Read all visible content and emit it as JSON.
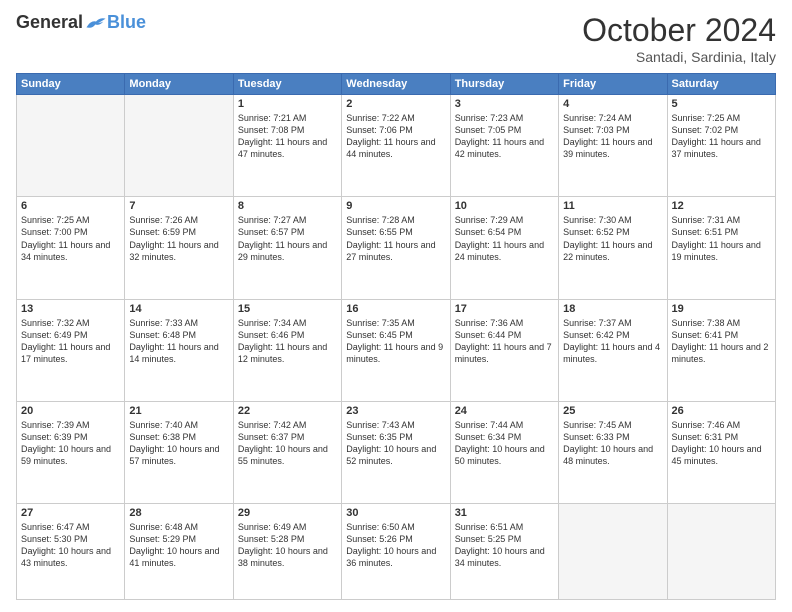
{
  "header": {
    "logo_general": "General",
    "logo_blue": "Blue",
    "month_title": "October 2024",
    "location": "Santadi, Sardinia, Italy"
  },
  "days_of_week": [
    "Sunday",
    "Monday",
    "Tuesday",
    "Wednesday",
    "Thursday",
    "Friday",
    "Saturday"
  ],
  "weeks": [
    [
      {
        "day": "",
        "empty": true
      },
      {
        "day": "",
        "empty": true
      },
      {
        "day": "1",
        "sunrise": "Sunrise: 7:21 AM",
        "sunset": "Sunset: 7:08 PM",
        "daylight": "Daylight: 11 hours and 47 minutes."
      },
      {
        "day": "2",
        "sunrise": "Sunrise: 7:22 AM",
        "sunset": "Sunset: 7:06 PM",
        "daylight": "Daylight: 11 hours and 44 minutes."
      },
      {
        "day": "3",
        "sunrise": "Sunrise: 7:23 AM",
        "sunset": "Sunset: 7:05 PM",
        "daylight": "Daylight: 11 hours and 42 minutes."
      },
      {
        "day": "4",
        "sunrise": "Sunrise: 7:24 AM",
        "sunset": "Sunset: 7:03 PM",
        "daylight": "Daylight: 11 hours and 39 minutes."
      },
      {
        "day": "5",
        "sunrise": "Sunrise: 7:25 AM",
        "sunset": "Sunset: 7:02 PM",
        "daylight": "Daylight: 11 hours and 37 minutes."
      }
    ],
    [
      {
        "day": "6",
        "sunrise": "Sunrise: 7:25 AM",
        "sunset": "Sunset: 7:00 PM",
        "daylight": "Daylight: 11 hours and 34 minutes."
      },
      {
        "day": "7",
        "sunrise": "Sunrise: 7:26 AM",
        "sunset": "Sunset: 6:59 PM",
        "daylight": "Daylight: 11 hours and 32 minutes."
      },
      {
        "day": "8",
        "sunrise": "Sunrise: 7:27 AM",
        "sunset": "Sunset: 6:57 PM",
        "daylight": "Daylight: 11 hours and 29 minutes."
      },
      {
        "day": "9",
        "sunrise": "Sunrise: 7:28 AM",
        "sunset": "Sunset: 6:55 PM",
        "daylight": "Daylight: 11 hours and 27 minutes."
      },
      {
        "day": "10",
        "sunrise": "Sunrise: 7:29 AM",
        "sunset": "Sunset: 6:54 PM",
        "daylight": "Daylight: 11 hours and 24 minutes."
      },
      {
        "day": "11",
        "sunrise": "Sunrise: 7:30 AM",
        "sunset": "Sunset: 6:52 PM",
        "daylight": "Daylight: 11 hours and 22 minutes."
      },
      {
        "day": "12",
        "sunrise": "Sunrise: 7:31 AM",
        "sunset": "Sunset: 6:51 PM",
        "daylight": "Daylight: 11 hours and 19 minutes."
      }
    ],
    [
      {
        "day": "13",
        "sunrise": "Sunrise: 7:32 AM",
        "sunset": "Sunset: 6:49 PM",
        "daylight": "Daylight: 11 hours and 17 minutes."
      },
      {
        "day": "14",
        "sunrise": "Sunrise: 7:33 AM",
        "sunset": "Sunset: 6:48 PM",
        "daylight": "Daylight: 11 hours and 14 minutes."
      },
      {
        "day": "15",
        "sunrise": "Sunrise: 7:34 AM",
        "sunset": "Sunset: 6:46 PM",
        "daylight": "Daylight: 11 hours and 12 minutes."
      },
      {
        "day": "16",
        "sunrise": "Sunrise: 7:35 AM",
        "sunset": "Sunset: 6:45 PM",
        "daylight": "Daylight: 11 hours and 9 minutes."
      },
      {
        "day": "17",
        "sunrise": "Sunrise: 7:36 AM",
        "sunset": "Sunset: 6:44 PM",
        "daylight": "Daylight: 11 hours and 7 minutes."
      },
      {
        "day": "18",
        "sunrise": "Sunrise: 7:37 AM",
        "sunset": "Sunset: 6:42 PM",
        "daylight": "Daylight: 11 hours and 4 minutes."
      },
      {
        "day": "19",
        "sunrise": "Sunrise: 7:38 AM",
        "sunset": "Sunset: 6:41 PM",
        "daylight": "Daylight: 11 hours and 2 minutes."
      }
    ],
    [
      {
        "day": "20",
        "sunrise": "Sunrise: 7:39 AM",
        "sunset": "Sunset: 6:39 PM",
        "daylight": "Daylight: 10 hours and 59 minutes."
      },
      {
        "day": "21",
        "sunrise": "Sunrise: 7:40 AM",
        "sunset": "Sunset: 6:38 PM",
        "daylight": "Daylight: 10 hours and 57 minutes."
      },
      {
        "day": "22",
        "sunrise": "Sunrise: 7:42 AM",
        "sunset": "Sunset: 6:37 PM",
        "daylight": "Daylight: 10 hours and 55 minutes."
      },
      {
        "day": "23",
        "sunrise": "Sunrise: 7:43 AM",
        "sunset": "Sunset: 6:35 PM",
        "daylight": "Daylight: 10 hours and 52 minutes."
      },
      {
        "day": "24",
        "sunrise": "Sunrise: 7:44 AM",
        "sunset": "Sunset: 6:34 PM",
        "daylight": "Daylight: 10 hours and 50 minutes."
      },
      {
        "day": "25",
        "sunrise": "Sunrise: 7:45 AM",
        "sunset": "Sunset: 6:33 PM",
        "daylight": "Daylight: 10 hours and 48 minutes."
      },
      {
        "day": "26",
        "sunrise": "Sunrise: 7:46 AM",
        "sunset": "Sunset: 6:31 PM",
        "daylight": "Daylight: 10 hours and 45 minutes."
      }
    ],
    [
      {
        "day": "27",
        "sunrise": "Sunrise: 6:47 AM",
        "sunset": "Sunset: 5:30 PM",
        "daylight": "Daylight: 10 hours and 43 minutes."
      },
      {
        "day": "28",
        "sunrise": "Sunrise: 6:48 AM",
        "sunset": "Sunset: 5:29 PM",
        "daylight": "Daylight: 10 hours and 41 minutes."
      },
      {
        "day": "29",
        "sunrise": "Sunrise: 6:49 AM",
        "sunset": "Sunset: 5:28 PM",
        "daylight": "Daylight: 10 hours and 38 minutes."
      },
      {
        "day": "30",
        "sunrise": "Sunrise: 6:50 AM",
        "sunset": "Sunset: 5:26 PM",
        "daylight": "Daylight: 10 hours and 36 minutes."
      },
      {
        "day": "31",
        "sunrise": "Sunrise: 6:51 AM",
        "sunset": "Sunset: 5:25 PM",
        "daylight": "Daylight: 10 hours and 34 minutes."
      },
      {
        "day": "",
        "empty": true
      },
      {
        "day": "",
        "empty": true
      }
    ]
  ]
}
